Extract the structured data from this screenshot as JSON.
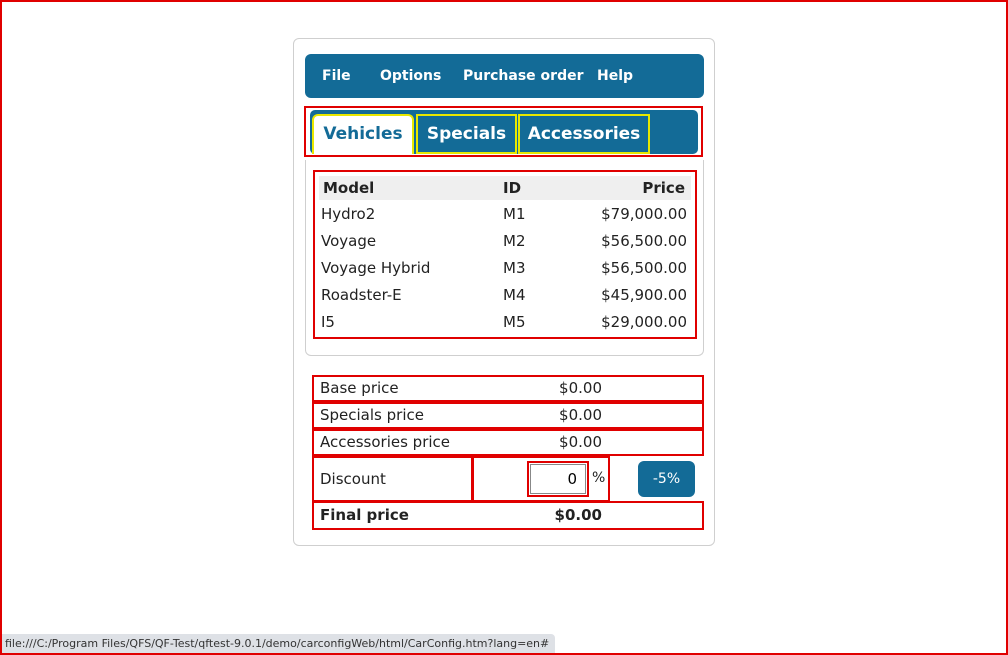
{
  "menu": {
    "items": [
      "File",
      "Options",
      "Purchase order",
      "Help"
    ]
  },
  "tabs": [
    {
      "label": "Vehicles",
      "active": true
    },
    {
      "label": "Specials",
      "active": false
    },
    {
      "label": "Accessories",
      "active": false
    }
  ],
  "vehicles": {
    "columns": [
      "Model",
      "ID",
      "Price"
    ],
    "rows": [
      {
        "model": "Hydro2",
        "id": "M1",
        "price": "$79,000.00"
      },
      {
        "model": "Voyage",
        "id": "M2",
        "price": "$56,500.00"
      },
      {
        "model": "Voyage Hybrid",
        "id": "M3",
        "price": "$56,500.00"
      },
      {
        "model": "Roadster-E",
        "id": "M4",
        "price": "$45,900.00"
      },
      {
        "model": "I5",
        "id": "M5",
        "price": "$29,000.00"
      }
    ]
  },
  "summary": {
    "base_label": "Base price",
    "base_value": "$0.00",
    "specials_label": "Specials price",
    "specials_value": "$0.00",
    "accessories_label": "Accessories price",
    "accessories_value": "$0.00",
    "discount_label": "Discount",
    "discount_value": "0",
    "discount_unit": "%",
    "discount_button": "-5%",
    "final_label": "Final price",
    "final_value": "$0.00"
  },
  "status": {
    "url": "file:///C:/Program Files/QFS/QF-Test/qftest-9.0.1/demo/carconfigWeb/html/CarConfig.htm?lang=en#"
  },
  "colors": {
    "accent": "#136b97",
    "highlight_red": "#e00000",
    "highlight_yellow": "#e8e800"
  }
}
